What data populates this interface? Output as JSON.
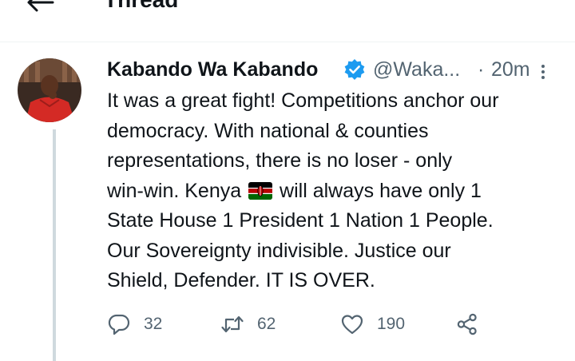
{
  "header": {
    "title": "Thread"
  },
  "tweet": {
    "author_name": "Kabando Wa Kabando",
    "handle": "@Waka...",
    "separator": "·",
    "time": "20m",
    "text_lines": [
      "It was a great fight! Competitions anchor our",
      "democracy. With national & counties",
      "representations, there is no loser - only",
      "State House 1 President 1 Nation 1 People.",
      "Our Sovereignty indivisible. Justice our",
      "Shield, Defender. IT IS OVER."
    ],
    "line4_before_flag": "win-win. Kenya",
    "line4_after_flag": "will always have only 1"
  },
  "actions": {
    "reply_count": "32",
    "retweet_count": "62",
    "like_count": "190"
  },
  "icons": {
    "back": "back-arrow-icon",
    "verified": "verified-badge-icon",
    "more": "more-options-icon",
    "reply": "reply-icon",
    "retweet": "retweet-icon",
    "like": "heart-icon",
    "share": "share-icon",
    "flag": "kenya-flag-emoji"
  },
  "colors": {
    "verified_blue": "#1d9bf0",
    "muted_text": "#536471",
    "thread_line": "#cfd9de"
  }
}
